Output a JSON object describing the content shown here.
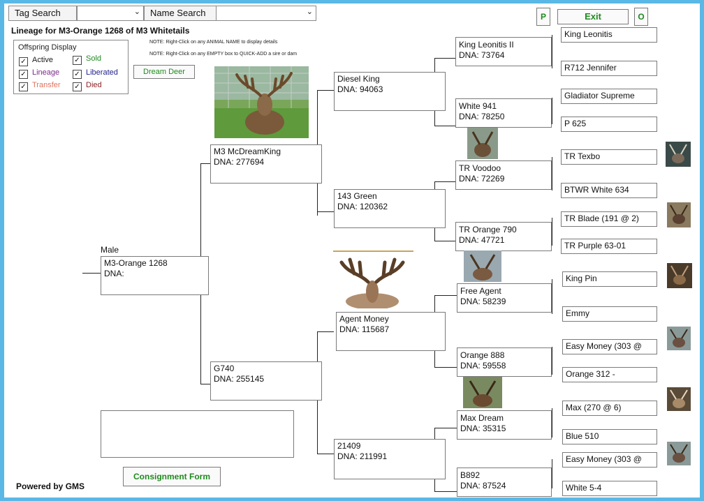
{
  "search": {
    "tag_label": "Tag Search",
    "name_label": "Name Search"
  },
  "buttons": {
    "p": "P",
    "exit": "Exit",
    "o": "O",
    "dream_deer": "Dream Deer",
    "consignment": "Consignment Form"
  },
  "title": "Lineage for M3-Orange 1268 of M3 Whitetails",
  "notes": [
    "NOTE: Right-Click on any ANIMAL NAME to display details",
    "NOTE: Right-Click on any EMPTY box to QUICK-ADD a sire or dam"
  ],
  "legend": {
    "title": "Offspring Display",
    "items": [
      {
        "label": "Active",
        "color": "#1a1a1a",
        "checked": "✓"
      },
      {
        "label": "Sold",
        "color": "#1f8a1f",
        "checked": "✓"
      },
      {
        "label": "Lineage",
        "color": "#7b2a8a",
        "checked": "✓"
      },
      {
        "label": "Liberated",
        "color": "#1f1f8a",
        "checked": "✓"
      },
      {
        "label": "Transfer",
        "color": "#e0745e",
        "checked": "✓"
      },
      {
        "label": "Died",
        "color": "#8a1f1f",
        "checked": "✓"
      }
    ]
  },
  "subject": {
    "sex": "Male",
    "name": "M3-Orange 1268",
    "dna": "DNA:"
  },
  "gen1": [
    {
      "name": "M3 McDreamKing",
      "dna": "DNA: 277694"
    },
    {
      "name": "G740",
      "dna": "DNA: 255145"
    }
  ],
  "gen2": [
    {
      "name": "Diesel King",
      "dna": "DNA: 94063"
    },
    {
      "name": "143 Green",
      "dna": "DNA: 120362"
    },
    {
      "name": "Agent Money",
      "dna": "DNA: 115687"
    },
    {
      "name": "21409",
      "dna": "DNA: 211991"
    }
  ],
  "gen3": [
    {
      "name": "King Leonitis II",
      "dna": "DNA: 73764"
    },
    {
      "name": "White 941",
      "dna": "DNA: 78250"
    },
    {
      "name": "TR Voodoo",
      "dna": "DNA: 72269"
    },
    {
      "name": "TR Orange 790",
      "dna": "DNA: 47721"
    },
    {
      "name": "Free Agent",
      "dna": "DNA: 58239"
    },
    {
      "name": "Orange 888",
      "dna": "DNA: 59558"
    },
    {
      "name": "Max Dream",
      "dna": "DNA: 35315"
    },
    {
      "name": "B892",
      "dna": "DNA: 87524"
    }
  ],
  "gen4": [
    "King Leonitis",
    "R712 Jennifer",
    "Gladiator Supreme",
    "P 625",
    "TR Texbo",
    "BTWR White 634",
    "TR Blade (191 @ 2)",
    "TR Purple 63-01",
    "King Pin",
    "Emmy",
    "Easy Money (303 @",
    "Orange 312 -",
    "Max (270 @ 6)",
    "Blue 510",
    "Easy Money (303 @",
    "White 5-4"
  ],
  "footer": "Powered by GMS"
}
